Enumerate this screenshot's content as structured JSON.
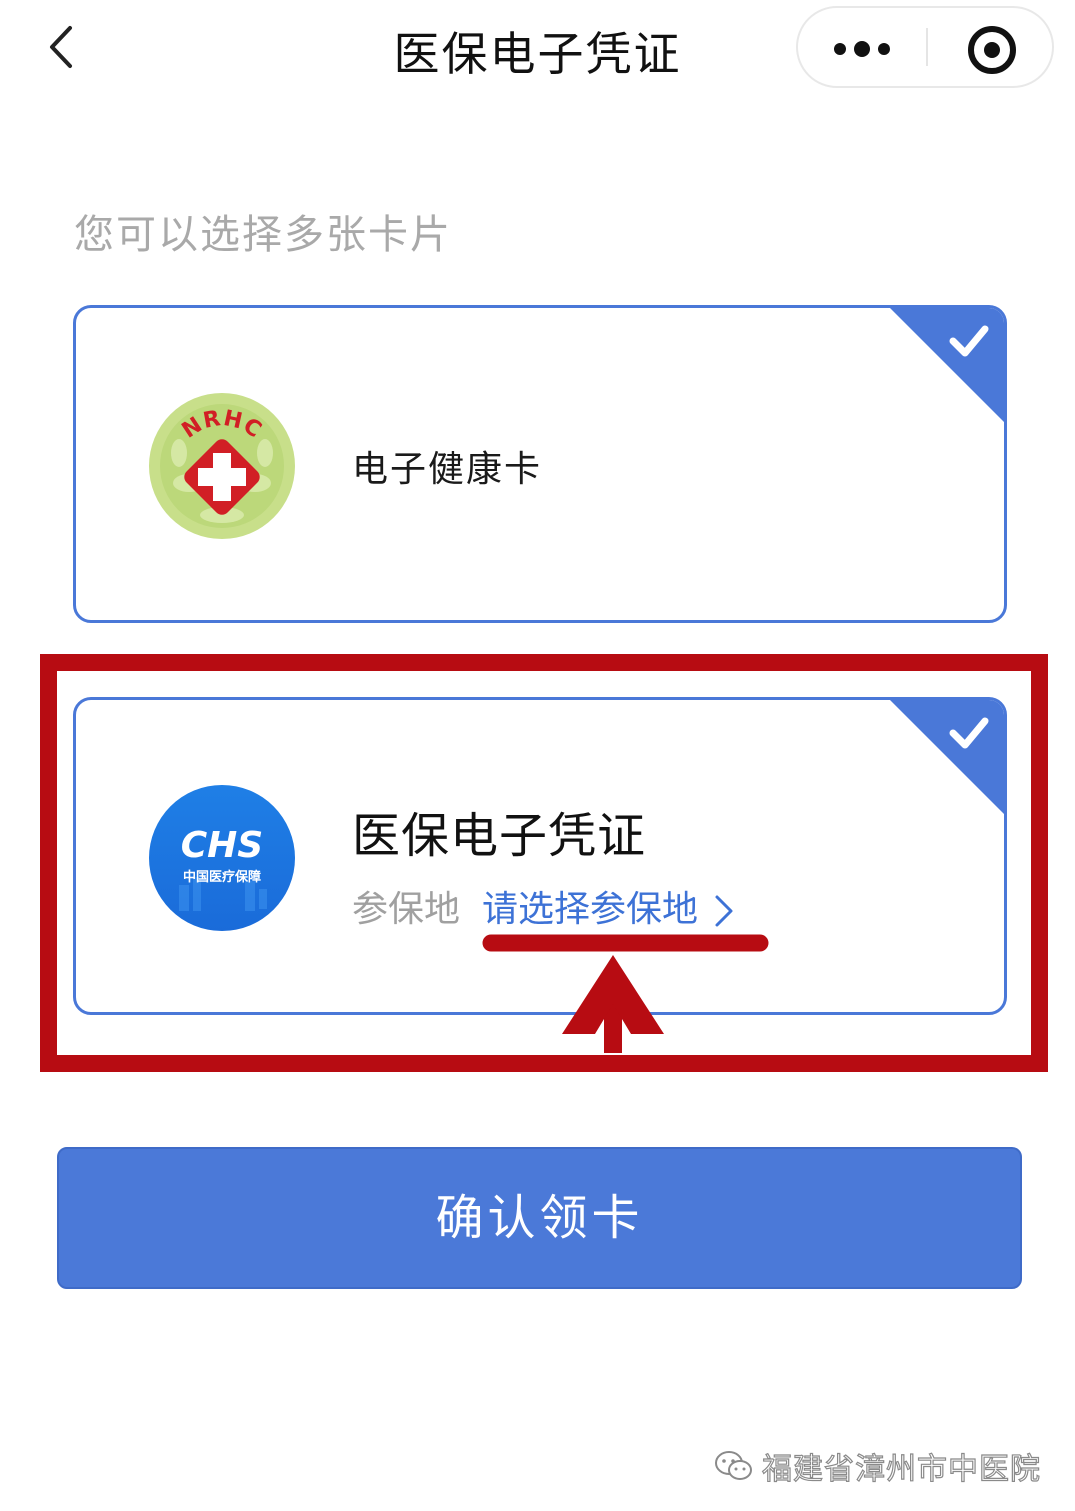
{
  "header": {
    "title": "医保电子凭证",
    "back_icon": "chevron-left-icon",
    "more_icon": "more-dots-icon",
    "close_icon": "target-close-icon"
  },
  "hint": "您可以选择多张卡片",
  "cards": [
    {
      "name": "电子健康卡",
      "logo_text": "NRHC",
      "selected": true
    },
    {
      "name": "医保电子凭证",
      "logo_text": "CHS",
      "logo_subtext": "中国医疗保障",
      "region_label": "参保地",
      "region_link": "请选择参保地",
      "selected": true
    }
  ],
  "confirm_button": "确认领卡",
  "watermark": "福建省漳州市中医院",
  "colors": {
    "accent": "#4b79d8",
    "card_border": "#4a78d8",
    "annotation": "#b70c12",
    "hint": "#a9a9a9"
  }
}
